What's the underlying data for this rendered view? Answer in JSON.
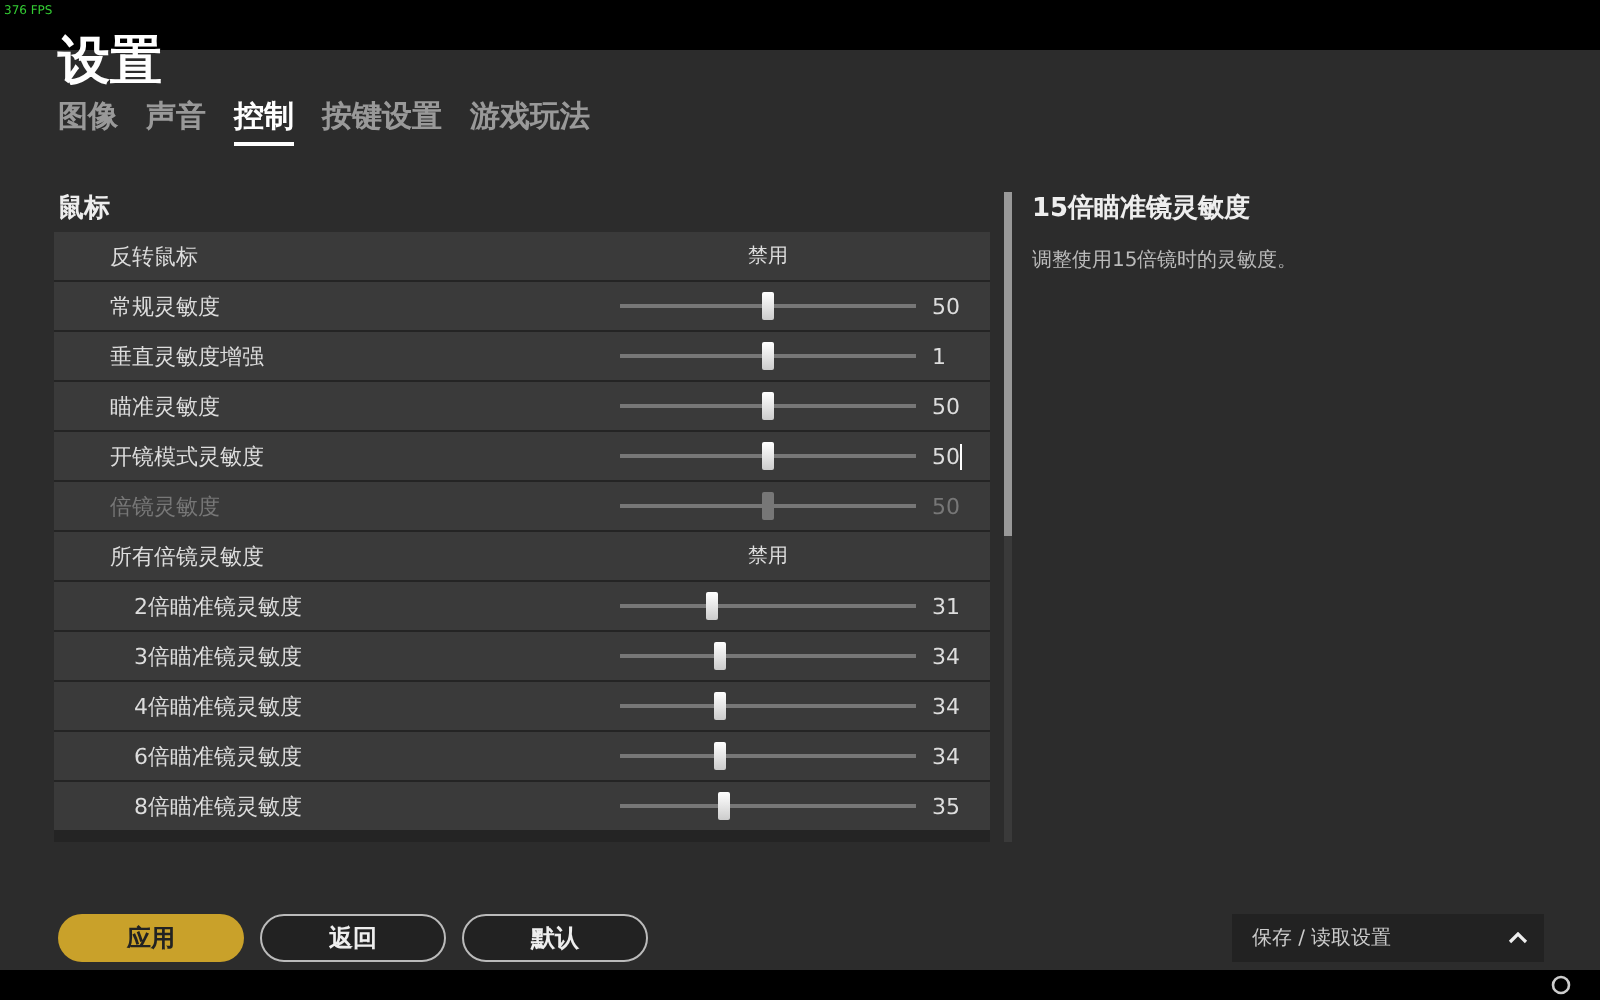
{
  "fps": "376 FPS",
  "title": "设置",
  "tabs": [
    {
      "label": "图像",
      "selected": false
    },
    {
      "label": "声音",
      "selected": false
    },
    {
      "label": "控制",
      "selected": true
    },
    {
      "label": "按键设置",
      "selected": false
    },
    {
      "label": "游戏玩法",
      "selected": false
    }
  ],
  "section": "鼠标",
  "rows": [
    {
      "kind": "toggle",
      "label": "反转鼠标",
      "value": "禁用",
      "disabled": false
    },
    {
      "kind": "slider",
      "label": "常规灵敏度",
      "level": 0.5,
      "value": "50",
      "disabled": false
    },
    {
      "kind": "slider",
      "label": "垂直灵敏度增强",
      "level": 0.5,
      "value": "1",
      "disabled": false
    },
    {
      "kind": "slider",
      "label": "瞄准灵敏度",
      "level": 0.5,
      "value": "50",
      "disabled": false
    },
    {
      "kind": "slider",
      "label": "开镜模式灵敏度",
      "level": 0.5,
      "value": "50",
      "disabled": false,
      "editing": true
    },
    {
      "kind": "slider",
      "label": "倍镜灵敏度",
      "level": 0.5,
      "value": "50",
      "disabled": true
    },
    {
      "kind": "toggle",
      "label": "所有倍镜灵敏度",
      "value": "禁用",
      "disabled": false,
      "children": [
        {
          "kind": "slider",
          "label": "2倍瞄准镜灵敏度",
          "level": 0.31,
          "value": "31",
          "disabled": false
        },
        {
          "kind": "slider",
          "label": "3倍瞄准镜灵敏度",
          "level": 0.34,
          "value": "34",
          "disabled": false
        },
        {
          "kind": "slider",
          "label": "4倍瞄准镜灵敏度",
          "level": 0.34,
          "value": "34",
          "disabled": false
        },
        {
          "kind": "slider",
          "label": "6倍瞄准镜灵敏度",
          "level": 0.34,
          "value": "34",
          "disabled": false
        },
        {
          "kind": "slider",
          "label": "8倍瞄准镜灵敏度",
          "level": 0.35,
          "value": "35",
          "disabled": false
        }
      ]
    }
  ],
  "info": {
    "title": "15倍瞄准镜灵敏度",
    "description": "调整使用15倍镜时的灵敏度。"
  },
  "buttons": [
    {
      "label": "应用",
      "kind": "primary"
    },
    {
      "label": "返回",
      "kind": "outline"
    },
    {
      "label": "默认",
      "kind": "outline"
    }
  ],
  "preset_menu": {
    "label": "保存 / 读取设置",
    "expanded": true
  }
}
